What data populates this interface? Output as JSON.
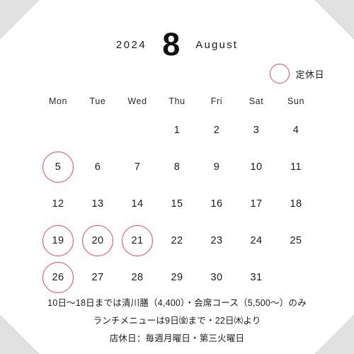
{
  "header": {
    "year": "2024",
    "month_number": "8",
    "month_name": "August"
  },
  "legend": {
    "marker_label": "定休日",
    "marker_color": "#e8495c"
  },
  "calendar": {
    "weekdays": [
      "Mon",
      "Tue",
      "Wed",
      "Thu",
      "Fri",
      "Sat",
      "Sun"
    ],
    "weeks": [
      [
        {
          "day": "",
          "marked": false
        },
        {
          "day": "",
          "marked": false
        },
        {
          "day": "",
          "marked": false
        },
        {
          "day": "1",
          "marked": false
        },
        {
          "day": "2",
          "marked": false
        },
        {
          "day": "3",
          "marked": false
        },
        {
          "day": "4",
          "marked": false
        }
      ],
      [
        {
          "day": "5",
          "marked": true
        },
        {
          "day": "6",
          "marked": false
        },
        {
          "day": "7",
          "marked": false
        },
        {
          "day": "8",
          "marked": false
        },
        {
          "day": "9",
          "marked": false
        },
        {
          "day": "10",
          "marked": false
        },
        {
          "day": "11",
          "marked": false
        }
      ],
      [
        {
          "day": "12",
          "marked": false
        },
        {
          "day": "13",
          "marked": false
        },
        {
          "day": "14",
          "marked": false
        },
        {
          "day": "15",
          "marked": false
        },
        {
          "day": "16",
          "marked": false
        },
        {
          "day": "17",
          "marked": false
        },
        {
          "day": "18",
          "marked": false
        }
      ],
      [
        {
          "day": "19",
          "marked": true
        },
        {
          "day": "20",
          "marked": true
        },
        {
          "day": "21",
          "marked": true
        },
        {
          "day": "22",
          "marked": false
        },
        {
          "day": "23",
          "marked": false
        },
        {
          "day": "24",
          "marked": false
        },
        {
          "day": "25",
          "marked": false
        }
      ],
      [
        {
          "day": "26",
          "marked": true
        },
        {
          "day": "27",
          "marked": false
        },
        {
          "day": "28",
          "marked": false
        },
        {
          "day": "29",
          "marked": false
        },
        {
          "day": "30",
          "marked": false
        },
        {
          "day": "31",
          "marked": false
        },
        {
          "day": "",
          "marked": false
        }
      ]
    ]
  },
  "notes": [
    "10日〜18日までは清川膳（4,400）・会席コース（5,500〜）のみ",
    "ランチメニューは9日㈮まで・22日㈭より",
    "店休日：毎週月曜日・第三火曜日"
  ],
  "colors": {
    "corner_gray": "#e1e1e1",
    "text": "#1a1a1a",
    "accent_red": "#e8495c"
  }
}
